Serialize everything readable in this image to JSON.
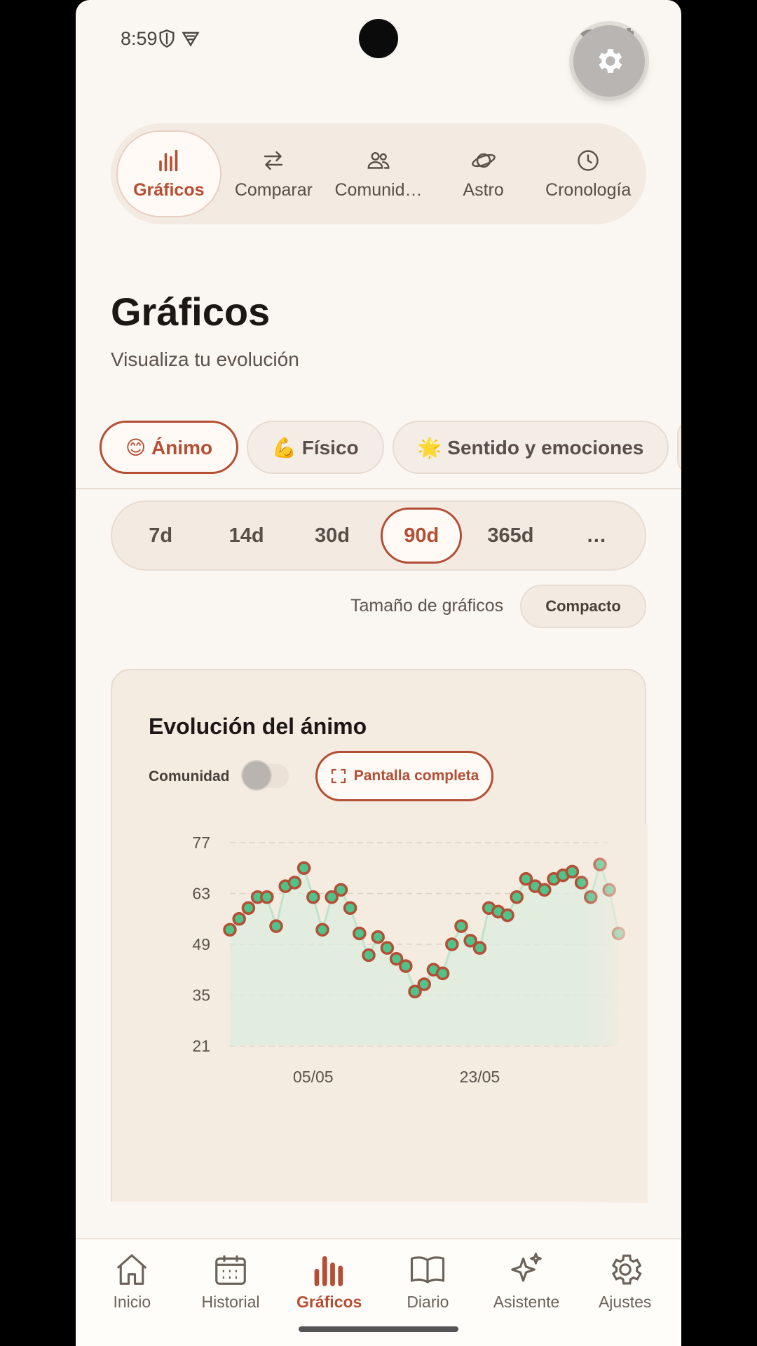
{
  "status_bar": {
    "time": "8:59"
  },
  "top_tabs": [
    {
      "label": "Gráficos",
      "icon": "bar-chart-icon",
      "active": true
    },
    {
      "label": "Comparar",
      "icon": "swap-arrows-icon",
      "active": false
    },
    {
      "label": "Comunid…",
      "icon": "people-icon",
      "active": false
    },
    {
      "label": "Astro",
      "icon": "planet-icon",
      "active": false
    },
    {
      "label": "Cronología",
      "icon": "clock-icon",
      "active": false
    }
  ],
  "header": {
    "title": "Gráficos",
    "subtitle": "Visualiza tu evolución"
  },
  "categories": [
    {
      "label": "😊 Ánimo",
      "active": true
    },
    {
      "label": "💪 Físico",
      "active": false
    },
    {
      "label": "🌟 Sentido y emociones",
      "active": false
    }
  ],
  "periods": [
    {
      "label": "7d",
      "active": false
    },
    {
      "label": "14d",
      "active": false
    },
    {
      "label": "30d",
      "active": false
    },
    {
      "label": "90d",
      "active": true
    },
    {
      "label": "365d",
      "active": false
    },
    {
      "label": "…",
      "active": false
    }
  ],
  "size_row": {
    "label": "Tamaño de gráficos",
    "value": "Compacto"
  },
  "card": {
    "title": "Evolución del ánimo",
    "community_label": "Comunidad",
    "community_enabled": false,
    "fullscreen_label": "Pantalla completa"
  },
  "chart_data": {
    "type": "line",
    "title": "Evolución del ánimo",
    "ylim": [
      21,
      77
    ],
    "y_ticks": [
      "77",
      "63",
      "49",
      "35",
      "21"
    ],
    "x_ticks": [
      {
        "label": "05/05",
        "index": 9
      },
      {
        "label": "23/05",
        "index": 27
      }
    ],
    "grid": true,
    "colors": {
      "line": "#bfe3cc",
      "area": "#dcecdd",
      "point_fill": "#4fc389",
      "point_stroke": "#b44e34",
      "grid": "#ddd2c8"
    },
    "values": [
      53,
      56,
      59,
      62,
      62,
      54,
      65,
      66,
      70,
      62,
      53,
      62,
      64,
      59,
      52,
      46,
      51,
      48,
      45,
      43,
      36,
      38,
      42,
      41,
      49,
      54,
      50,
      48,
      59,
      58,
      57,
      62,
      67,
      65,
      64,
      67,
      68,
      69,
      66,
      62,
      71,
      64,
      52
    ]
  },
  "bottom_nav": [
    {
      "label": "Inicio",
      "icon": "home-icon",
      "active": false
    },
    {
      "label": "Historial",
      "icon": "calendar-icon",
      "active": false
    },
    {
      "label": "Gráficos",
      "icon": "bar-chart-icon",
      "active": true
    },
    {
      "label": "Diario",
      "icon": "book-icon",
      "active": false
    },
    {
      "label": "Asistente",
      "icon": "sparkles-icon",
      "active": false
    },
    {
      "label": "Ajustes",
      "icon": "gear-icon",
      "active": false
    }
  ]
}
